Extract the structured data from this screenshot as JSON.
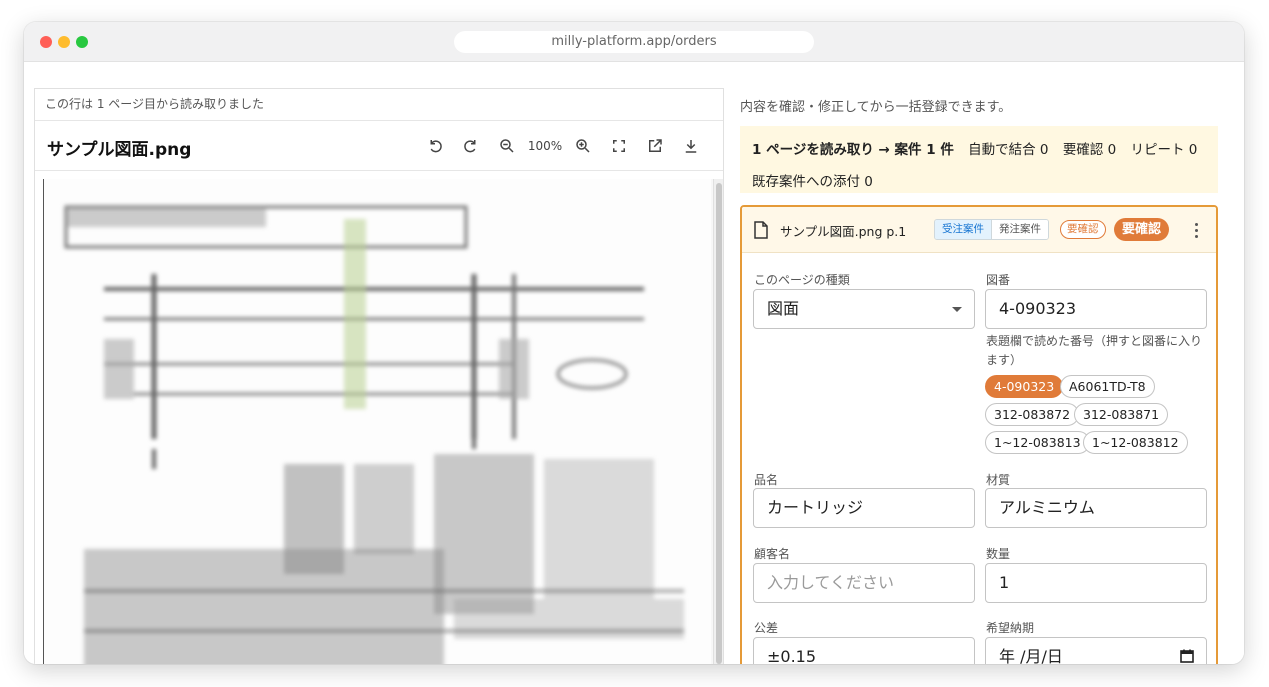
{
  "browser": {
    "url": "milly-platform.app/orders"
  },
  "left_panel": {
    "note": "この行は 1 ページ目から読み取りました",
    "file_title": "サンプル図面.png",
    "zoom": "100%"
  },
  "right_panel": {
    "intro": "内容を確認・修正してから一括登録できます。",
    "summary": {
      "lead": "1 ページを読み取り → 案件 1 件",
      "auto_merge": "自動で結合 0",
      "needs_check": "要確認 0",
      "repeat": "リピート 0",
      "attach_existing": "既存案件への添付 0"
    },
    "card": {
      "file_page": "サンプル図面.png p.1",
      "toggle": [
        "受注案件",
        "発注案件"
      ],
      "badge_outline": "要確認",
      "badge_solid": "要確認",
      "fields": {
        "page_type": {
          "label": "このページの種類",
          "value": "図面"
        },
        "drawing_no": {
          "label": "図番",
          "value": "4-090323"
        },
        "hint": "表題欄で読めた番号（押すと図番に入ります）",
        "candidates": [
          "4-090323",
          "A6061TD-T8",
          "312-083872",
          "312-083871",
          "1~12-083813",
          "1~12-083812"
        ],
        "product_name": {
          "label": "品名",
          "value": "カートリッジ"
        },
        "material": {
          "label": "材質",
          "value": "アルミニウム"
        },
        "customer": {
          "label": "顧客名",
          "placeholder": "入力してください"
        },
        "quantity": {
          "label": "数量",
          "value": "1"
        },
        "tolerance": {
          "label": "公差",
          "value": "±0.15"
        },
        "due_date": {
          "label": "希望納期",
          "value": "年 /月/日"
        }
      }
    }
  }
}
